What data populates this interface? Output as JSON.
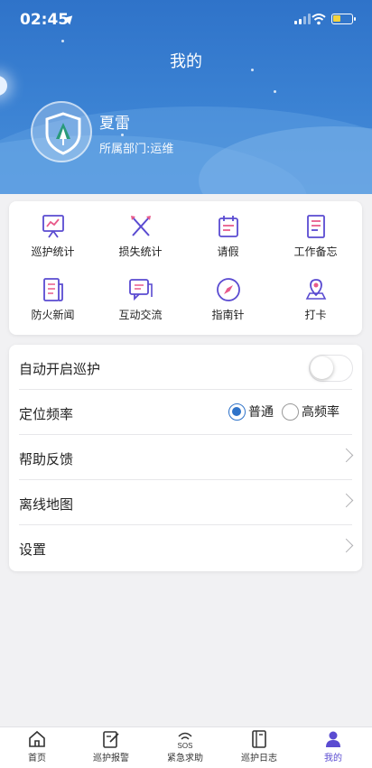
{
  "status": {
    "time": "02:45"
  },
  "header": {
    "title": "我的"
  },
  "user": {
    "name": "夏雷",
    "department": "所属部门:运维"
  },
  "grid": [
    {
      "label": "巡护统计",
      "icon": "chart-board-icon"
    },
    {
      "label": "损失统计",
      "icon": "crossed-tools-icon"
    },
    {
      "label": "请假",
      "icon": "calendar-icon"
    },
    {
      "label": "工作备忘",
      "icon": "memo-icon"
    },
    {
      "label": "防火新闻",
      "icon": "news-icon"
    },
    {
      "label": "互动交流",
      "icon": "chat-icon"
    },
    {
      "label": "指南针",
      "icon": "compass-icon"
    },
    {
      "label": "打卡",
      "icon": "map-pin-icon"
    }
  ],
  "settings": {
    "auto_patrol": {
      "label": "自动开启巡护",
      "enabled": false
    },
    "location_freq": {
      "label": "定位频率",
      "options": [
        "普通",
        "高频率"
      ],
      "selected": "普通"
    },
    "help": {
      "label": "帮助反馈"
    },
    "offline_map": {
      "label": "离线地图"
    },
    "setup": {
      "label": "设置"
    }
  },
  "tabs": [
    {
      "label": "首页",
      "icon": "home-icon"
    },
    {
      "label": "巡护报警",
      "icon": "report-edit-icon"
    },
    {
      "label": "紧急求助",
      "icon": "sos-icon"
    },
    {
      "label": "巡护日志",
      "icon": "log-book-icon"
    },
    {
      "label": "我的",
      "icon": "person-icon",
      "active": true
    }
  ],
  "colors": {
    "primary": "#2f73c9",
    "accent": "#5a4bd1"
  }
}
